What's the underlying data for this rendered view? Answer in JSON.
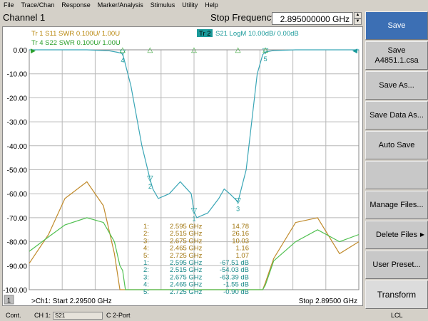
{
  "menu": [
    "File",
    "Trace/Chan",
    "Response",
    "Marker/Analysis",
    "Stimulus",
    "Utility",
    "Help"
  ],
  "channel_title": "Channel 1",
  "stop_freq_label": "Stop Frequency",
  "stop_freq_value": "2.895000000 GHz",
  "traces": [
    {
      "text": "Tr  1  S11 SWR 0.100U/  1.00U",
      "color": "#b8860b"
    },
    {
      "text": "S21 LogM 10.00dB/  0.00dB",
      "color": "#1a9a9a",
      "tag": "Tr  2"
    },
    {
      "text": "Tr  4  S22 SWR 0.100U/  1.00U",
      "color": "#2ca02c"
    }
  ],
  "y_ticks": [
    "0.00",
    "-10.00",
    "-20.00",
    "-30.00",
    "-40.00",
    "-50.00",
    "-60.00",
    "-70.00",
    "-80.00",
    "-90.00",
    "-100.00"
  ],
  "marker_table": [
    {
      "n": "1:",
      "f": "2.595 GHz",
      "v": "14.78",
      "c": "#a0740c"
    },
    {
      "n": "2:",
      "f": "2.515 GHz",
      "v": "26.16",
      "c": "#a0740c"
    },
    {
      "n": "3:",
      "f": "2.675 GHz",
      "v": "10.03",
      "c": "#a0740c"
    },
    {
      "n": "4:",
      "f": "2.465 GHz",
      "v": "1.16",
      "c": "#a0740c"
    },
    {
      "n": "5:",
      "f": "2.725 GHz",
      "v": "1.07",
      "c": "#a0740c"
    },
    {
      "n": "1:",
      "f": "2.595 GHz",
      "v": "-67.51 dB",
      "c": "#1a8a8a"
    },
    {
      "n": "2:",
      "f": "2.515 GHz",
      "v": "-54.03 dB",
      "c": "#1a8a8a"
    },
    {
      "n": "3:",
      "f": "2.675 GHz",
      "v": "-63.39 dB",
      "c": "#1a8a8a"
    },
    {
      "n": "4:",
      "f": "2.465 GHz",
      "v": "-1.55 dB",
      "c": "#1a8a8a"
    },
    {
      "n": "5:",
      "f": "2.725 GHz",
      "v": "-0.90 dB",
      "c": "#1a8a8a"
    }
  ],
  "marker_labels": [
    "1",
    "2",
    "3",
    "4",
    "5"
  ],
  "chart_start": ">Ch1: Start  2.29500 GHz",
  "chart_stop": "Stop  2.89500 GHz",
  "chart_index": "1",
  "softkeys": [
    {
      "label": "Save",
      "sub": ""
    },
    {
      "label": "Save",
      "sub": "A4851.1.csa"
    },
    {
      "label": "Save As...",
      "sub": ""
    },
    {
      "label": "Save Data As...",
      "sub": ""
    },
    {
      "label": "Auto Save",
      "sub": ""
    },
    {
      "label": "",
      "sub": ""
    },
    {
      "label": "Manage Files...",
      "sub": ""
    },
    {
      "label": "Delete Files",
      "sub": ""
    },
    {
      "label": "User Preset...",
      "sub": ""
    },
    {
      "label": "Transform",
      "sub": ""
    }
  ],
  "status": {
    "cont": "Cont.",
    "ch": "CH 1:",
    "param": "S21",
    "port": "C  2-Port",
    "lcl": "LCL"
  },
  "chart_data": {
    "type": "line",
    "xlim": [
      2.295,
      2.895
    ],
    "ylim": [
      -100,
      0
    ],
    "series": [
      {
        "name": "S21 LogM",
        "color": "#3aa6b6",
        "x": [
          2.295,
          2.35,
          2.4,
          2.44,
          2.455,
          2.465,
          2.48,
          2.5,
          2.515,
          2.52,
          2.53,
          2.55,
          2.57,
          2.59,
          2.595,
          2.6,
          2.62,
          2.64,
          2.65,
          2.66,
          2.675,
          2.69,
          2.71,
          2.72,
          2.725,
          2.74,
          2.78,
          2.83,
          2.895
        ],
        "y": [
          0,
          0,
          0,
          -0.4,
          -1,
          -1.55,
          -15,
          -40,
          -54.03,
          -58,
          -62,
          -60,
          -55,
          -60,
          -67.51,
          -70,
          -68,
          -62,
          -58,
          -60,
          -63.39,
          -50,
          -10,
          -2,
          -0.9,
          -0.3,
          0,
          0,
          0
        ]
      },
      {
        "name": "S11 SWR",
        "color": "#c08a2a",
        "x": [
          2.295,
          2.33,
          2.36,
          2.4,
          2.43,
          2.45,
          2.46,
          2.465,
          2.47,
          2.5,
          2.55,
          2.6,
          2.65,
          2.7,
          2.71,
          2.72,
          2.725,
          2.74,
          2.78,
          2.82,
          2.86,
          2.895
        ],
        "y": [
          -89,
          -77,
          -62,
          -55,
          -65,
          -85,
          -100,
          -100,
          -100,
          -100,
          -100,
          -100,
          -100,
          -100,
          -100,
          -100,
          -97,
          -87,
          -72,
          -70,
          -85,
          -80
        ]
      },
      {
        "name": "S22 SWR",
        "color": "#50c050",
        "x": [
          2.295,
          2.33,
          2.36,
          2.4,
          2.43,
          2.45,
          2.46,
          2.465,
          2.47,
          2.5,
          2.55,
          2.6,
          2.65,
          2.7,
          2.71,
          2.72,
          2.725,
          2.74,
          2.78,
          2.82,
          2.86,
          2.895
        ],
        "y": [
          -84,
          -78,
          -73,
          -70,
          -72,
          -80,
          -90,
          -92,
          -100,
          -100,
          -100,
          -100,
          -100,
          -100,
          -100,
          -100,
          -98,
          -88,
          -80,
          -75,
          -80,
          -77
        ]
      }
    ],
    "markers": [
      2.595,
      2.515,
      2.675,
      2.465,
      2.725
    ]
  }
}
